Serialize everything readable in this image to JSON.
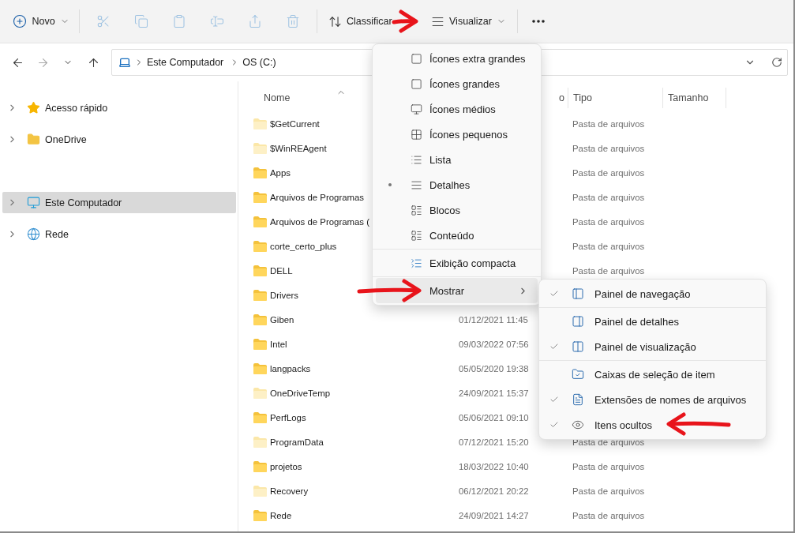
{
  "toolbar": {
    "new_button": {
      "label": "Novo"
    },
    "actions": [
      {
        "disabled": true
      },
      {
        "disabled": true
      },
      {
        "disabled": true
      },
      {
        "disabled": true
      },
      {
        "disabled": true
      },
      {
        "disabled": true
      }
    ],
    "sort_button": {
      "label": "Classificar"
    },
    "view_button": {
      "label": "Visualizar"
    }
  },
  "navigation": {
    "back": {
      "disabled": false
    },
    "forward": {
      "disabled": true
    }
  },
  "address_bar": {
    "segments": [
      "Este Computador",
      "OS (C:)"
    ]
  },
  "sidebar": {
    "items": [
      {
        "label": "Acesso rápido",
        "selected": false
      },
      {
        "label": "OneDrive",
        "selected": false
      },
      {
        "label": "Este Computador",
        "selected": true
      },
      {
        "label": "Rede",
        "selected": false
      }
    ]
  },
  "table": {
    "columns": [
      "Nome",
      "o",
      "Tipo",
      "Tamanho"
    ],
    "rows": [
      {
        "name": "$GetCurrent",
        "hidden": true,
        "type": "Pasta de arquivos"
      },
      {
        "name": "$WinREAgent",
        "hidden": true,
        "type": "Pasta de arquivos"
      },
      {
        "name": "Apps",
        "hidden": false,
        "type": "Pasta de arquivos"
      },
      {
        "name": "Arquivos de Programas",
        "hidden": false,
        "type": "Pasta de arquivos"
      },
      {
        "name": "Arquivos de Programas (",
        "hidden": false,
        "type": "Pasta de arquivos"
      },
      {
        "name": "corte_certo_plus",
        "hidden": false,
        "type": "Pasta de arquivos"
      },
      {
        "name": "DELL",
        "hidden": false,
        "type": "Pasta de arquivos"
      },
      {
        "name": "Drivers",
        "hidden": false
      },
      {
        "name": "Giben",
        "hidden": false,
        "date": "01/12/2021 11:45"
      },
      {
        "name": "Intel",
        "hidden": false,
        "date": "09/03/2022 07:56"
      },
      {
        "name": "langpacks",
        "hidden": false,
        "date": "05/05/2020 19:38"
      },
      {
        "name": "OneDriveTemp",
        "hidden": true,
        "date": "24/09/2021 15:37"
      },
      {
        "name": "PerfLogs",
        "hidden": false,
        "date": "05/06/2021 09:10"
      },
      {
        "name": "ProgramData",
        "hidden": true,
        "date": "07/12/2021 15:20",
        "type": "Pasta de arquivos"
      },
      {
        "name": "projetos",
        "hidden": false,
        "date": "18/03/2022 10:40",
        "type": "Pasta de arquivos"
      },
      {
        "name": "Recovery",
        "hidden": true,
        "date": "06/12/2021 20:22",
        "type": "Pasta de arquivos"
      },
      {
        "name": "Rede",
        "hidden": false,
        "date": "24/09/2021 14:27",
        "type": "Pasta de arquivos"
      }
    ]
  },
  "view_menu": {
    "items": [
      {
        "kind": "item",
        "label": "Ícones extra grandes",
        "selected": false
      },
      {
        "kind": "item",
        "label": "Ícones grandes",
        "selected": false
      },
      {
        "kind": "item",
        "label": "Ícones médios",
        "selected": false
      },
      {
        "kind": "item",
        "label": "Ícones pequenos",
        "selected": false
      },
      {
        "kind": "item",
        "label": "Lista",
        "selected": false
      },
      {
        "kind": "item",
        "label": "Detalhes",
        "selected": true
      },
      {
        "kind": "item",
        "label": "Blocos",
        "selected": false
      },
      {
        "kind": "item",
        "label": "Conteúdo",
        "selected": false
      },
      {
        "kind": "separator"
      },
      {
        "kind": "item",
        "label": "Exibição compacta",
        "selected": false
      },
      {
        "kind": "separator"
      },
      {
        "kind": "submenu",
        "label": "Mostrar",
        "highlighted": true
      }
    ]
  },
  "show_submenu": {
    "items": [
      {
        "kind": "item",
        "label": "Painel de navegação",
        "checked": true
      },
      {
        "kind": "separator"
      },
      {
        "kind": "item",
        "label": "Painel de detalhes",
        "checked": false
      },
      {
        "kind": "item",
        "label": "Painel de visualização",
        "checked": true
      },
      {
        "kind": "separator"
      },
      {
        "kind": "item",
        "label": "Caixas de seleção de item",
        "checked": false
      },
      {
        "kind": "item",
        "label": "Extensões de nomes de arquivos",
        "checked": true
      },
      {
        "kind": "item",
        "label": "Itens ocultos",
        "checked": true
      }
    ]
  },
  "annotations": [
    {
      "kind": "rightarrow"
    },
    {
      "kind": "rightarrow"
    },
    {
      "kind": "leftarrow"
    }
  ]
}
